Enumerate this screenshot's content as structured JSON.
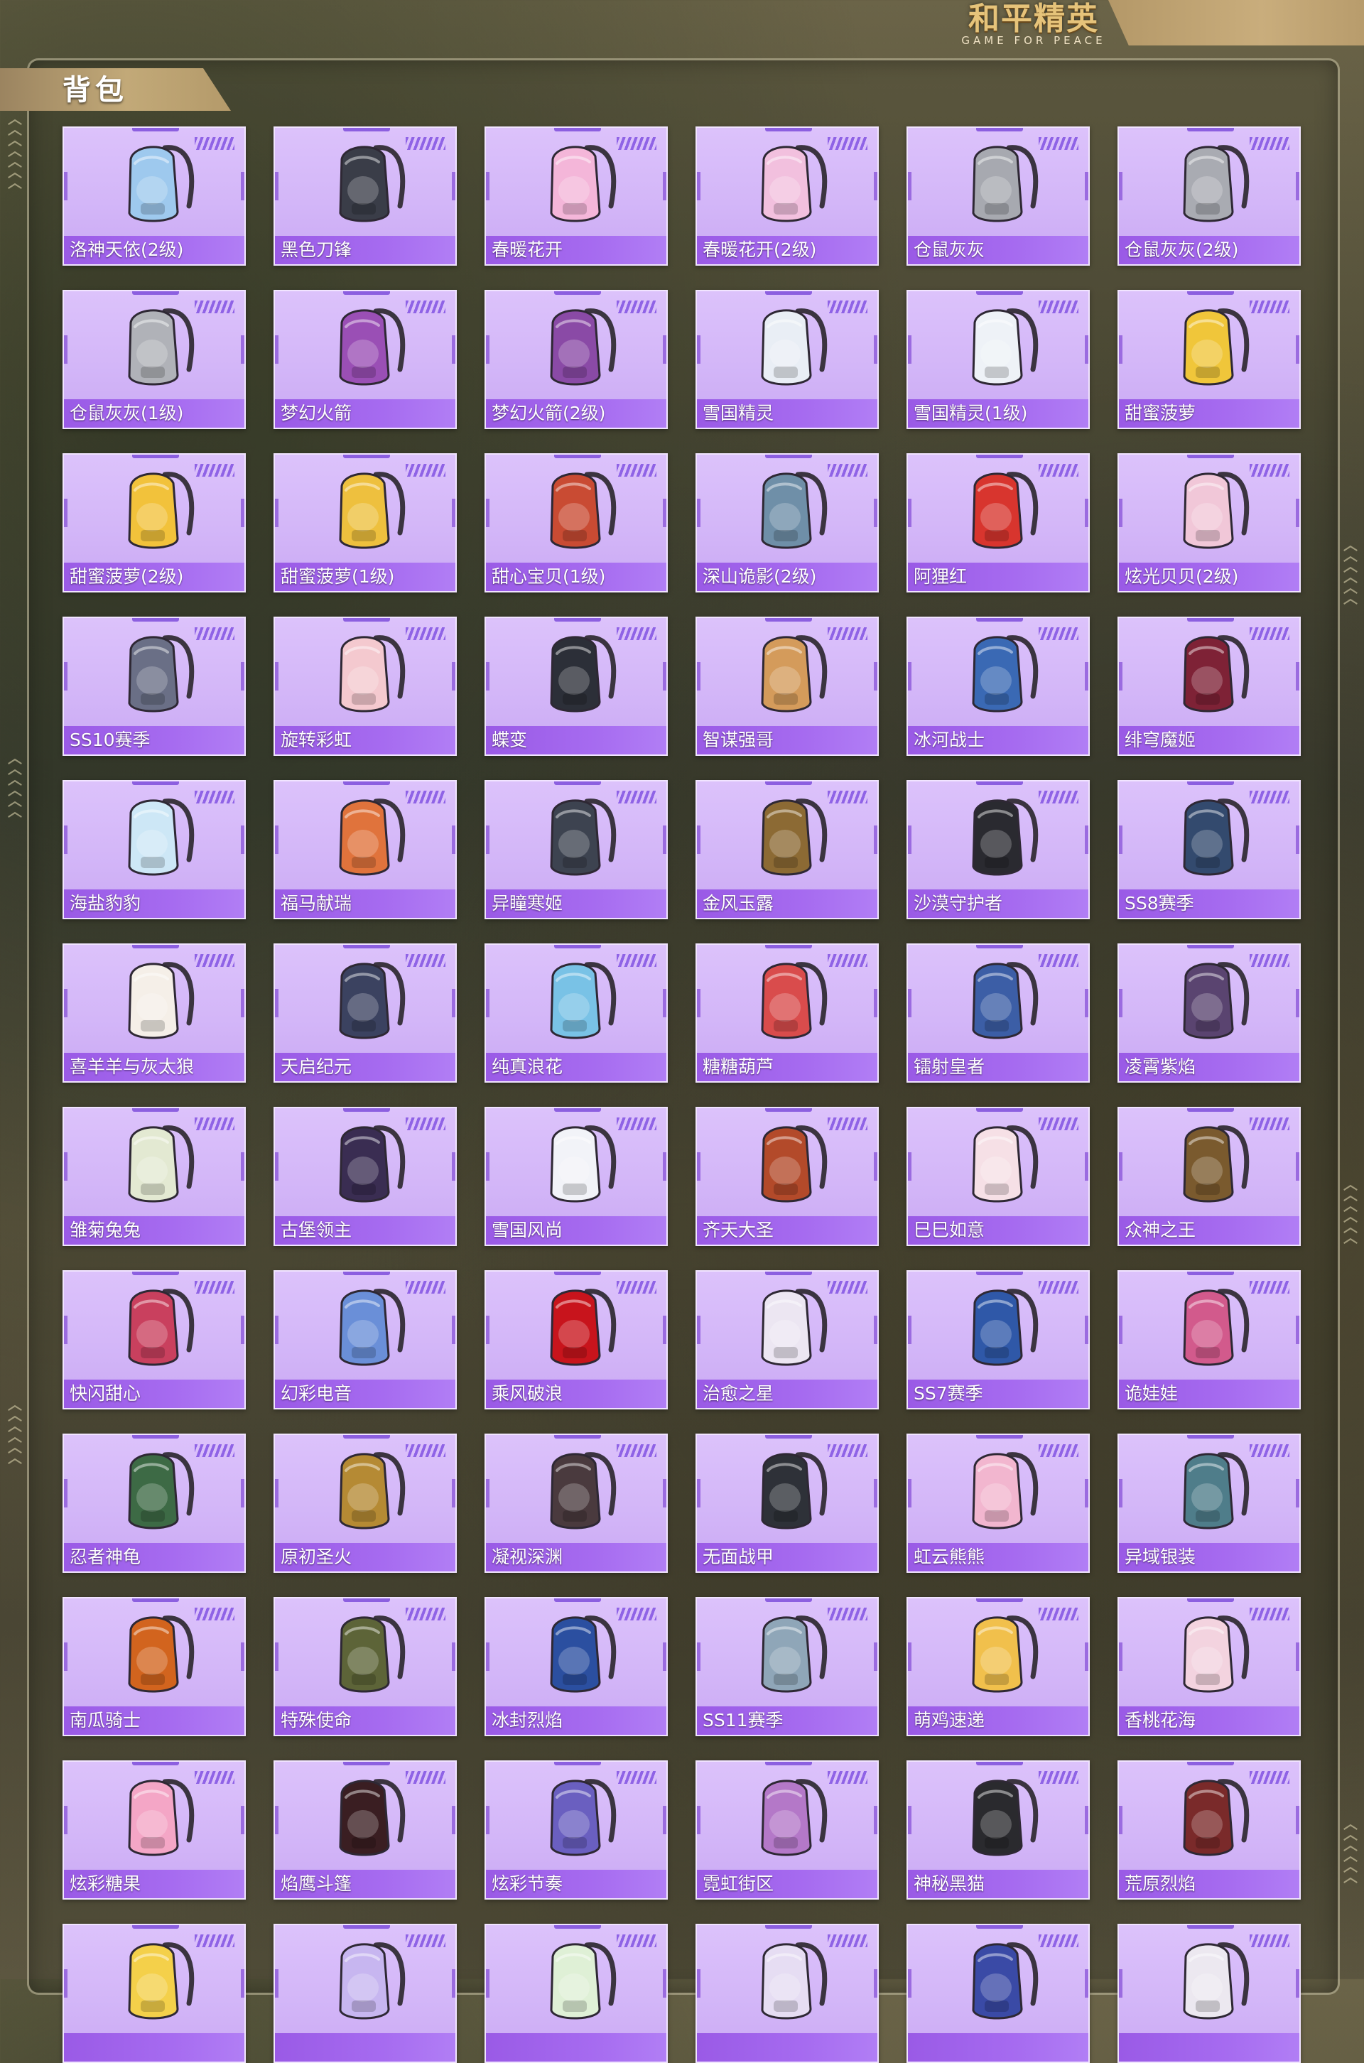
{
  "header": {
    "logo_cn": "和平精英",
    "logo_en": "GAME FOR PEACE"
  },
  "panel": {
    "title": "背包"
  },
  "items": [
    {
      "name": "洛神天依(2级)",
      "color": "#9ec9ee",
      "icon": "backpack-icon"
    },
    {
      "name": "黑色刀锋",
      "color": "#3a3d48",
      "icon": "backpack-icon"
    },
    {
      "name": "春暖花开",
      "color": "#f4b6d9",
      "icon": "backpack-icon"
    },
    {
      "name": "春暖花开(2级)",
      "color": "#f2c0de",
      "icon": "backpack-icon"
    },
    {
      "name": "仓鼠灰灰",
      "color": "#a7a9b0",
      "icon": "backpack-icon"
    },
    {
      "name": "仓鼠灰灰(2级)",
      "color": "#a9abb2",
      "icon": "backpack-icon"
    },
    {
      "name": "仓鼠灰灰(1级)",
      "color": "#b0b2b8",
      "icon": "backpack-icon"
    },
    {
      "name": "梦幻火箭",
      "color": "#9a4fb5",
      "icon": "backpack-icon"
    },
    {
      "name": "梦幻火箭(2级)",
      "color": "#8a4aa6",
      "icon": "backpack-icon"
    },
    {
      "name": "雪国精灵",
      "color": "#e9eef5",
      "icon": "backpack-icon"
    },
    {
      "name": "雪国精灵(1级)",
      "color": "#eef2f7",
      "icon": "backpack-icon"
    },
    {
      "name": "甜蜜菠萝",
      "color": "#f0c63a",
      "icon": "backpack-icon"
    },
    {
      "name": "甜蜜菠萝(2级)",
      "color": "#f2c23b",
      "icon": "backpack-icon"
    },
    {
      "name": "甜蜜菠萝(1级)",
      "color": "#eec03e",
      "icon": "backpack-icon"
    },
    {
      "name": "甜心宝贝(1级)",
      "color": "#c94b33",
      "icon": "backpack-icon"
    },
    {
      "name": "深山诡影(2级)",
      "color": "#6f8fa8",
      "icon": "backpack-icon"
    },
    {
      "name": "阿狸红",
      "color": "#d8352e",
      "icon": "backpack-icon"
    },
    {
      "name": "炫光贝贝(2级)",
      "color": "#f1c7d8",
      "icon": "backpack-icon"
    },
    {
      "name": "SS10赛季",
      "color": "#6a6f86",
      "icon": "backpack-icon"
    },
    {
      "name": "旋转彩虹",
      "color": "#f4c9cf",
      "icon": "backpack-icon"
    },
    {
      "name": "蝶变",
      "color": "#2c2f38",
      "icon": "backpack-icon"
    },
    {
      "name": "智谋强哥",
      "color": "#d49b5b",
      "icon": "backpack-icon"
    },
    {
      "name": "冰河战士",
      "color": "#3a69b4",
      "icon": "backpack-icon"
    },
    {
      "name": "绯穹魔姬",
      "color": "#7e2236",
      "icon": "backpack-icon"
    },
    {
      "name": "海盐豹豹",
      "color": "#cde7f6",
      "icon": "backpack-icon"
    },
    {
      "name": "福马献瑞",
      "color": "#e0733c",
      "icon": "backpack-icon"
    },
    {
      "name": "异瞳寒姬",
      "color": "#3d4350",
      "icon": "backpack-icon"
    },
    {
      "name": "金风玉露",
      "color": "#8c6a34",
      "icon": "backpack-icon"
    },
    {
      "name": "沙漠守护者",
      "color": "#2a2a30",
      "icon": "backpack-icon"
    },
    {
      "name": "SS8赛季",
      "color": "#334a6e",
      "icon": "backpack-icon"
    },
    {
      "name": "喜羊羊与灰太狼",
      "color": "#f5efe8",
      "icon": "backpack-icon"
    },
    {
      "name": "天启纪元",
      "color": "#3b4260",
      "icon": "backpack-icon"
    },
    {
      "name": "纯真浪花",
      "color": "#79c2e6",
      "icon": "backpack-icon"
    },
    {
      "name": "糖糖葫芦",
      "color": "#d94c4c",
      "icon": "backpack-icon"
    },
    {
      "name": "镭射皇者",
      "color": "#3c5ea6",
      "icon": "backpack-icon"
    },
    {
      "name": "凌霄紫焰",
      "color": "#5a4470",
      "icon": "backpack-icon"
    },
    {
      "name": "雏菊兔兔",
      "color": "#e3e9d2",
      "icon": "backpack-icon"
    },
    {
      "name": "古堡领主",
      "color": "#3a2d52",
      "icon": "backpack-icon"
    },
    {
      "name": "雪国风尚",
      "color": "#f2f3f8",
      "icon": "backpack-icon"
    },
    {
      "name": "齐天大圣",
      "color": "#b34a2a",
      "icon": "backpack-icon"
    },
    {
      "name": "巳巳如意",
      "color": "#f6e0e6",
      "icon": "backpack-icon"
    },
    {
      "name": "众神之王",
      "color": "#7a5a2e",
      "icon": "backpack-icon"
    },
    {
      "name": "快闪甜心",
      "color": "#c9405e",
      "icon": "backpack-icon"
    },
    {
      "name": "幻彩电音",
      "color": "#6a8fd8",
      "icon": "backpack-icon"
    },
    {
      "name": "乘风破浪",
      "color": "#c8141c",
      "icon": "backpack-icon"
    },
    {
      "name": "治愈之星",
      "color": "#ece6f2",
      "icon": "backpack-icon"
    },
    {
      "name": "SS7赛季",
      "color": "#2f58a8",
      "icon": "backpack-icon"
    },
    {
      "name": "诡娃娃",
      "color": "#d25a8c",
      "icon": "backpack-icon"
    },
    {
      "name": "忍者神龟",
      "color": "#3d6a45",
      "icon": "backpack-icon"
    },
    {
      "name": "原初圣火",
      "color": "#b58a34",
      "icon": "backpack-icon"
    },
    {
      "name": "凝视深渊",
      "color": "#4a3a3e",
      "icon": "backpack-icon"
    },
    {
      "name": "无面战甲",
      "color": "#2e3138",
      "icon": "backpack-icon"
    },
    {
      "name": "虹云熊熊",
      "color": "#f2b6cf",
      "icon": "backpack-icon"
    },
    {
      "name": "异域银装",
      "color": "#4f7d8a",
      "icon": "backpack-icon"
    },
    {
      "name": "南瓜骑士",
      "color": "#d2641e",
      "icon": "backpack-icon"
    },
    {
      "name": "特殊使命",
      "color": "#5d6438",
      "icon": "backpack-icon"
    },
    {
      "name": "冰封烈焰",
      "color": "#2b4fa0",
      "icon": "backpack-icon"
    },
    {
      "name": "SS11赛季",
      "color": "#8fa6b8",
      "icon": "backpack-icon"
    },
    {
      "name": "萌鸡速递",
      "color": "#f1c04c",
      "icon": "backpack-icon"
    },
    {
      "name": "香桃花海",
      "color": "#f3d3df",
      "icon": "backpack-icon"
    },
    {
      "name": "炫彩糖果",
      "color": "#f4a6c6",
      "icon": "backpack-icon"
    },
    {
      "name": "焰鹰斗篷",
      "color": "#3a1e22",
      "icon": "backpack-icon"
    },
    {
      "name": "炫彩节奏",
      "color": "#6a5fc0",
      "icon": "backpack-icon"
    },
    {
      "name": "霓虹街区",
      "color": "#b478c8",
      "icon": "backpack-icon"
    },
    {
      "name": "神秘黑猫",
      "color": "#2a2a2e",
      "icon": "backpack-icon"
    },
    {
      "name": "荒原烈焰",
      "color": "#7a2a2a",
      "icon": "backpack-icon"
    },
    {
      "name": "",
      "color": "#f4d04a",
      "icon": "backpack-icon"
    },
    {
      "name": "",
      "color": "#c7b6f0",
      "icon": "backpack-icon"
    },
    {
      "name": "",
      "color": "#dff0d6",
      "icon": "backpack-icon"
    },
    {
      "name": "",
      "color": "#e6ddf3",
      "icon": "backpack-icon"
    },
    {
      "name": "",
      "color": "#3a4aa6",
      "icon": "backpack-icon"
    },
    {
      "name": "",
      "color": "#ece8f0",
      "icon": "backpack-icon"
    }
  ]
}
